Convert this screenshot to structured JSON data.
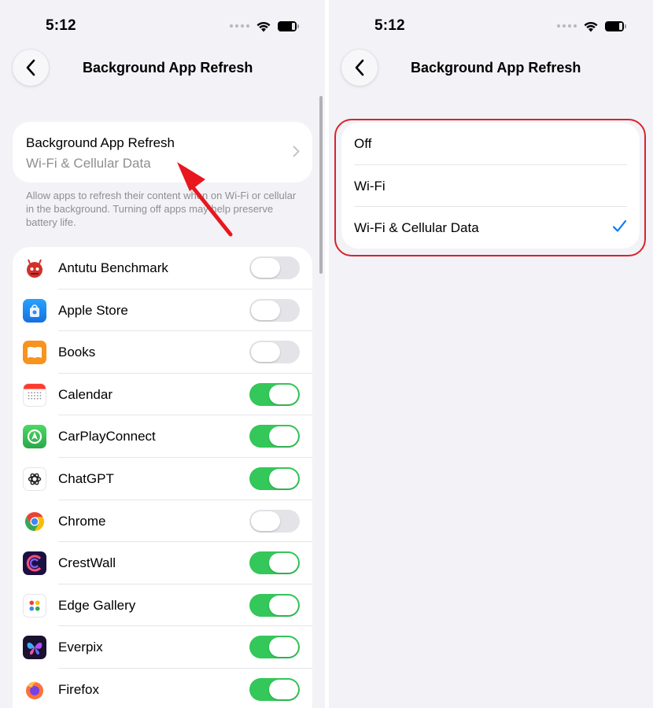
{
  "status_bar": {
    "time": "5:12"
  },
  "nav": {
    "title": "Background App Refresh"
  },
  "left": {
    "setting": {
      "label": "Background App Refresh",
      "value": "Wi-Fi & Cellular Data"
    },
    "footnote": "Allow apps to refresh their content when on Wi-Fi or cellular in the background. Turning off apps may help preserve battery life.",
    "apps": [
      {
        "name": "Antutu Benchmark",
        "on": false,
        "icon": "antutu-icon"
      },
      {
        "name": "Apple Store",
        "on": false,
        "icon": "apple-store-icon"
      },
      {
        "name": "Books",
        "on": false,
        "icon": "books-icon"
      },
      {
        "name": "Calendar",
        "on": true,
        "icon": "calendar-icon"
      },
      {
        "name": "CarPlayConnect",
        "on": true,
        "icon": "carplayconnect-icon"
      },
      {
        "name": "ChatGPT",
        "on": true,
        "icon": "chatgpt-icon"
      },
      {
        "name": "Chrome",
        "on": false,
        "icon": "chrome-icon"
      },
      {
        "name": "CrestWall",
        "on": true,
        "icon": "crestwall-icon"
      },
      {
        "name": "Edge Gallery",
        "on": true,
        "icon": "edge-gallery-icon"
      },
      {
        "name": "Everpix",
        "on": true,
        "icon": "everpix-icon"
      },
      {
        "name": "Firefox",
        "on": true,
        "icon": "firefox-icon"
      }
    ]
  },
  "right": {
    "options": [
      {
        "label": "Off",
        "selected": false
      },
      {
        "label": "Wi-Fi",
        "selected": false
      },
      {
        "label": "Wi-Fi & Cellular Data",
        "selected": true
      }
    ]
  },
  "colors": {
    "toggle_on": "#34c759",
    "toggle_off": "#e3e3e8",
    "checkmark": "#007aff",
    "annotation_red": "#d9232a"
  }
}
